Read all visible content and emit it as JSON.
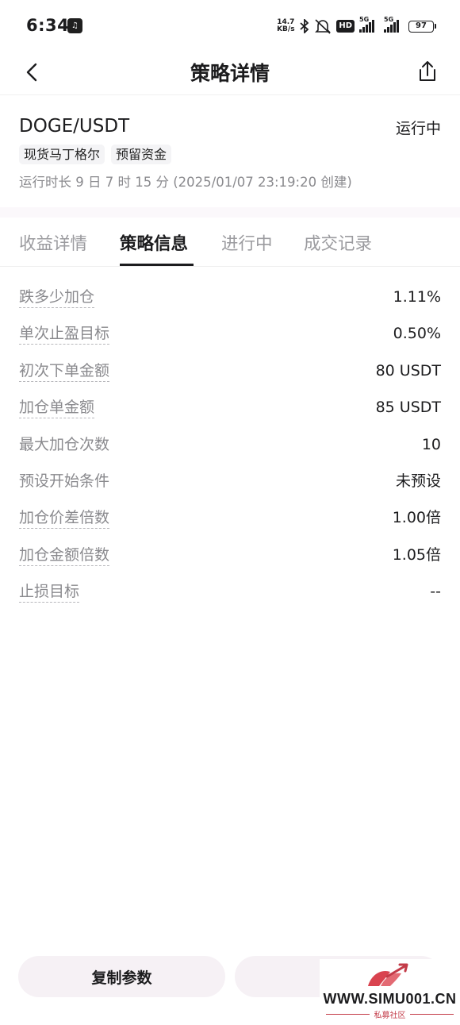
{
  "status_bar": {
    "time": "6:34",
    "net_speed_value": "14.7",
    "net_speed_unit": "KB/s",
    "hd_label": "HD",
    "signal_1_label": "5G",
    "signal_2_label": "5G",
    "battery": "97"
  },
  "header": {
    "title": "策略详情"
  },
  "summary": {
    "pair": "DOGE/USDT",
    "status": "运行中",
    "tags": [
      "现货马丁格尔",
      "预留资金"
    ],
    "runtime": "运行时长 9 日 7 时 15 分 (2025/01/07 23:19:20 创建)"
  },
  "tabs": [
    {
      "label": "收益详情",
      "active": false
    },
    {
      "label": "策略信息",
      "active": true
    },
    {
      "label": "进行中",
      "active": false
    },
    {
      "label": "成交记录",
      "active": false
    }
  ],
  "params": [
    {
      "label": "跌多少加仓",
      "value": "1.11%",
      "dashed": true
    },
    {
      "label": "单次止盈目标",
      "value": "0.50%",
      "dashed": true
    },
    {
      "label": "初次下单金额",
      "value": "80 USDT",
      "dashed": true
    },
    {
      "label": "加仓单金额",
      "value": "85 USDT",
      "dashed": true
    },
    {
      "label": "最大加仓次数",
      "value": "10",
      "dashed": false
    },
    {
      "label": "预设开始条件",
      "value": "未预设",
      "dashed": false
    },
    {
      "label": "加仓价差倍数",
      "value": "1.00倍",
      "dashed": true
    },
    {
      "label": "加仓金额倍数",
      "value": "1.05倍",
      "dashed": true
    },
    {
      "label": "止损目标",
      "value": "--",
      "dashed": true
    }
  ],
  "footer": {
    "copy_label": "复制参数"
  },
  "watermark": {
    "site": "WWW.SIMU001.CN",
    "subtitle": "私募社区"
  },
  "colors": {
    "text_primary": "#1c1c1e",
    "text_secondary": "#8a8a8e",
    "tab_inactive": "#9b9b9f",
    "button_bg": "#f6f1f5",
    "watermark_red": "#c33b48"
  }
}
